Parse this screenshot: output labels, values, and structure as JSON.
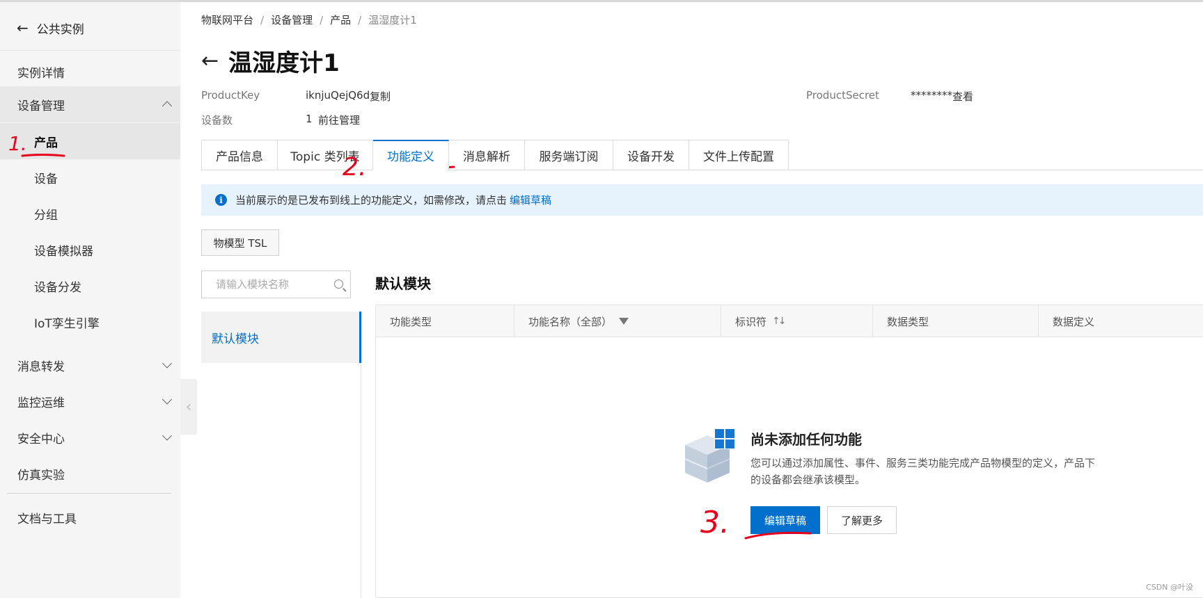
{
  "sidebar": {
    "back_label": "公共实例",
    "items": [
      {
        "label": "实例详情"
      },
      {
        "label": "设备管理"
      },
      {
        "label": "产品"
      },
      {
        "label": "设备"
      },
      {
        "label": "分组"
      },
      {
        "label": "设备模拟器"
      },
      {
        "label": "设备分发"
      },
      {
        "label": "IoT孪生引擎"
      },
      {
        "label": "消息转发"
      },
      {
        "label": "监控运维"
      },
      {
        "label": "安全中心"
      },
      {
        "label": "仿真实验"
      },
      {
        "label": "文档与工具"
      }
    ]
  },
  "breadcrumb": [
    "物联网平台",
    "设备管理",
    "产品",
    "温湿度计1"
  ],
  "page": {
    "title": "温湿度计1",
    "product_key_label": "ProductKey",
    "product_key_value": "iknjuQejQ6d",
    "copy_link": "复制",
    "product_secret_label": "ProductSecret",
    "product_secret_value": "********",
    "view_link": "查看",
    "device_count_label": "设备数",
    "device_count_value": "1",
    "manage_link": "前往管理"
  },
  "tabs": [
    {
      "label": "产品信息"
    },
    {
      "label": "Topic 类列表"
    },
    {
      "label": "功能定义",
      "active": true
    },
    {
      "label": "消息解析"
    },
    {
      "label": "服务端订阅"
    },
    {
      "label": "设备开发"
    },
    {
      "label": "文件上传配置"
    }
  ],
  "notice": {
    "text": "当前展示的是已发布到线上的功能定义，如需修改，请点击",
    "link": "编辑草稿"
  },
  "tsl_button": "物模型 TSL",
  "module_search": {
    "placeholder": "请输入模块名称"
  },
  "modules": [
    {
      "label": "默认模块"
    }
  ],
  "module_title": "默认模块",
  "table": {
    "columns": [
      "功能类型",
      "功能名称（全部）",
      "标识符",
      "数据类型",
      "数据定义"
    ]
  },
  "empty_state": {
    "title": "尚未添加任何功能",
    "description": "您可以通过添加属性、事件、服务三类功能完成产品物模型的定义，产品下的设备都会继承该模型。",
    "primary_button": "编辑草稿",
    "secondary_button": "了解更多"
  },
  "annotations": [
    "1.",
    "2.",
    "3."
  ],
  "watermark": "CSDN @叶没",
  "colors": {
    "accent": "#0070cc",
    "annotation": "#e6001c",
    "notice_bg": "#e6f3fd"
  }
}
